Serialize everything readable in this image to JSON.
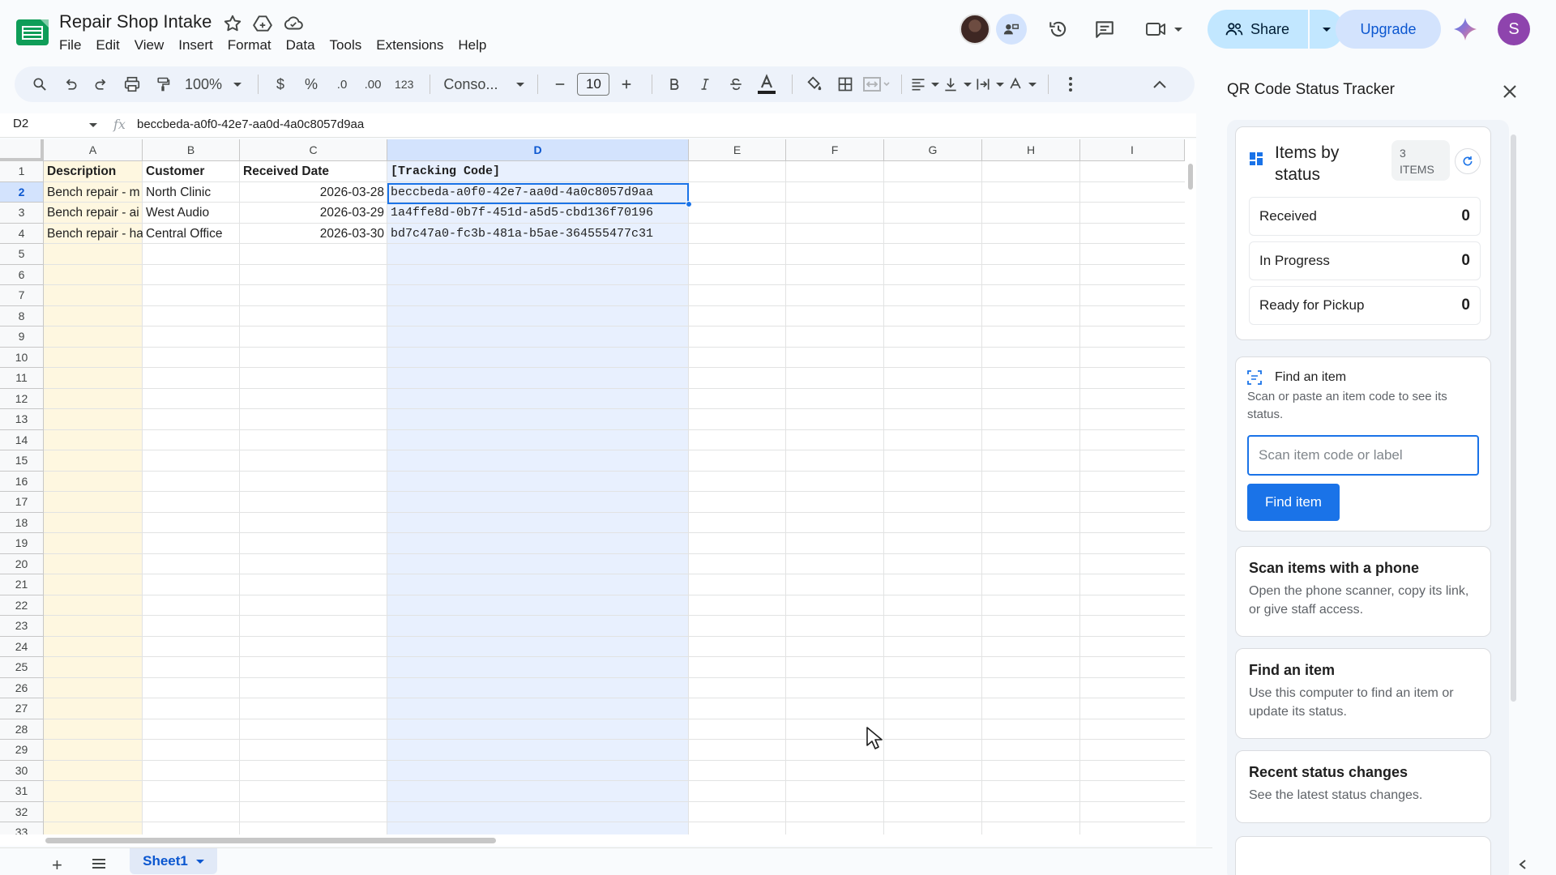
{
  "header": {
    "title": "Repair Shop Intake",
    "menu": [
      "File",
      "Edit",
      "View",
      "Insert",
      "Format",
      "Data",
      "Tools",
      "Extensions",
      "Help"
    ],
    "share_label": "Share",
    "upgrade_label": "Upgrade",
    "user_initial": "S"
  },
  "toolbar": {
    "zoom": "100%",
    "currency": "$",
    "percent": "%",
    "dec_decrease": ".0",
    "dec_increase": ".00",
    "number_format": "123",
    "font": "Conso...",
    "font_size": "10"
  },
  "formula_bar": {
    "cell_ref": "D2",
    "fx": "fx",
    "content": "beccbeda-a0f0-42e7-aa0d-4a0c8057d9aa"
  },
  "grid": {
    "columns": [
      "A",
      "B",
      "C",
      "D",
      "E",
      "F",
      "G",
      "H",
      "I"
    ],
    "rows": [
      "1",
      "2",
      "3",
      "4",
      "5",
      "6",
      "7",
      "8",
      "9",
      "10",
      "11",
      "12",
      "13",
      "14",
      "15",
      "16",
      "17",
      "18",
      "19",
      "20",
      "21",
      "22",
      "23",
      "24",
      "25",
      "26",
      "27",
      "28",
      "29",
      "30",
      "31",
      "32",
      "33"
    ],
    "headers": [
      "Description",
      "Customer",
      "Received Date",
      "[Tracking Code]"
    ],
    "data": [
      [
        "Bench repair - m",
        "North Clinic",
        "2026-03-28",
        "beccbeda-a0f0-42e7-aa0d-4a0c8057d9aa"
      ],
      [
        "Bench repair - ai",
        "West Audio",
        "2026-03-29",
        "1a4ffe8d-0b7f-451d-a5d5-cbd136f70196"
      ],
      [
        "Bench repair - ha",
        "Central Office",
        "2026-03-30",
        "bd7c47a0-fc3b-481a-b5ae-364555477c31"
      ]
    ]
  },
  "sheet_tab": "Sheet1",
  "panel": {
    "title": "QR Code Status Tracker",
    "status": {
      "title": "Items by status",
      "count": "3",
      "count_unit": "ITEMS",
      "rows": [
        {
          "label": "Received",
          "value": "0"
        },
        {
          "label": "In Progress",
          "value": "0"
        },
        {
          "label": "Ready for Pickup",
          "value": "0"
        }
      ]
    },
    "find": {
      "title": "Find an item",
      "desc": "Scan or paste an item code to see its status.",
      "placeholder": "Scan item code or label",
      "button": "Find item"
    },
    "cards": [
      {
        "title": "Scan items with a phone",
        "desc": "Open the phone scanner, copy its link, or give staff access."
      },
      {
        "title": "Find an item",
        "desc": "Use this computer to find an item or update its status."
      },
      {
        "title": "Recent status changes",
        "desc": "See the latest status changes."
      }
    ]
  },
  "colors": {
    "accent": "#1a73e8",
    "selected_col": "#e8f0fe",
    "col_a_tint": "#fef7e0"
  }
}
